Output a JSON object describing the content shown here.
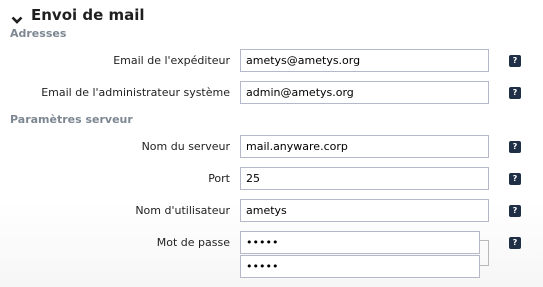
{
  "section": {
    "title": "Envoi de mail",
    "collapse_icon": "chevron-down-icon"
  },
  "groups": {
    "adresses": "Adresses",
    "serveur": "Paramètres serveur"
  },
  "fields": {
    "sender_email": {
      "label": "Email de l'expéditeur",
      "value": "ametys@ametys.org"
    },
    "admin_email": {
      "label": "Email de l'administrateur système",
      "value": "admin@ametys.org"
    },
    "server_name": {
      "label": "Nom du serveur",
      "value": "mail.anyware.corp"
    },
    "port": {
      "label": "Port",
      "value": "25"
    },
    "username": {
      "label": "Nom d'utilisateur",
      "value": "ametys"
    },
    "password": {
      "label": "Mot de passe",
      "value": "•••••",
      "confirm_value": "•••••"
    }
  },
  "help_icon": {
    "glyph": "?",
    "name": "help-icon"
  },
  "colors": {
    "help_bg": "#1f2f46",
    "section_title": "#7d8792",
    "input_border": "#b5b8c8"
  }
}
